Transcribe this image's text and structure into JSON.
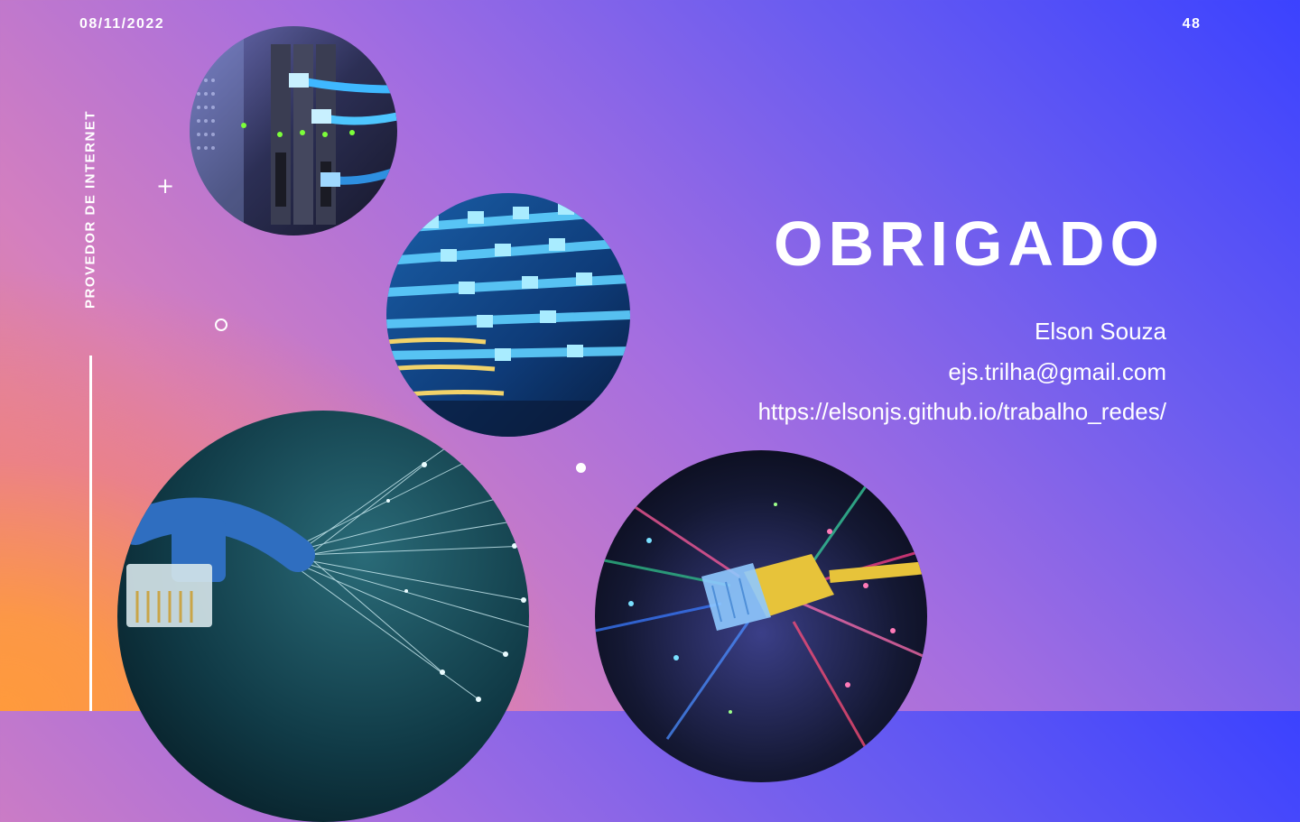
{
  "slide": {
    "date": "08/11/2022",
    "page_number": "48",
    "section_title": "PROVEDOR DE INTERNET",
    "heading": "OBRIGADO",
    "contact": {
      "name": "Elson Souza",
      "email": "ejs.trilha@gmail.com",
      "url": "https://elsonjs.github.io/trabalho_redes/"
    }
  },
  "images": [
    {
      "name": "server-rack-photo",
      "icon": "network-switch-image"
    },
    {
      "name": "patch-cables-photo",
      "icon": "ethernet-cables-image"
    },
    {
      "name": "fiber-ethernet-photo",
      "icon": "fiber-optic-image"
    },
    {
      "name": "fiber-connector-photo",
      "icon": "fiber-plug-image"
    }
  ],
  "colors": {
    "text": "#ffffff",
    "gradient_top_right": "#3b42ff",
    "gradient_middle": "#a56ee0",
    "gradient_bottom_left": "#ff9a3c"
  }
}
